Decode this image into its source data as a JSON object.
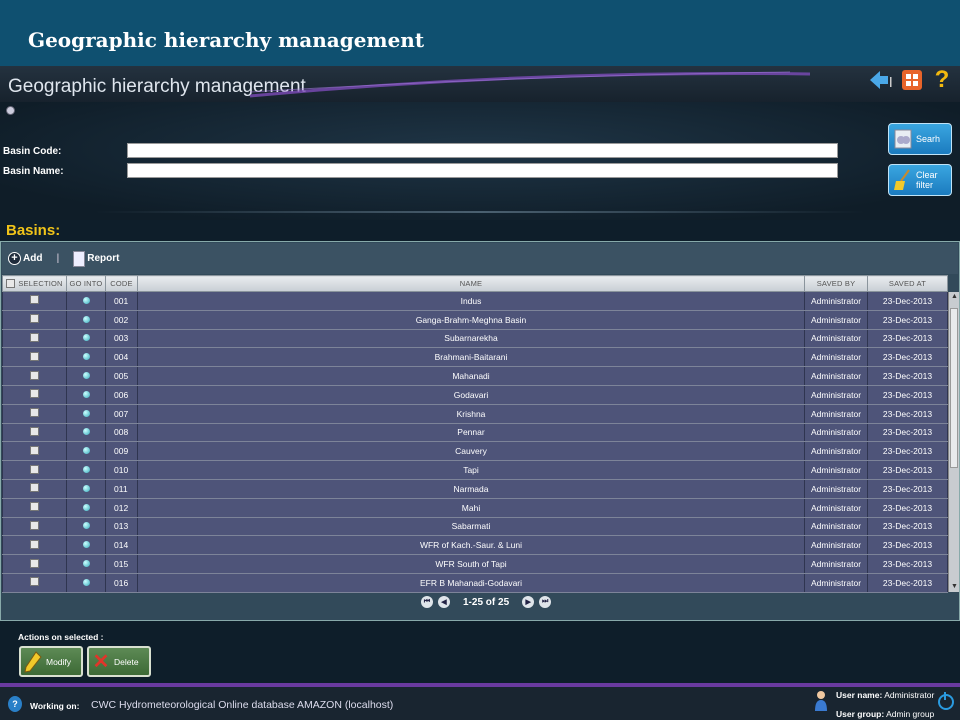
{
  "slide": {
    "title": "Geographic hierarchy management"
  },
  "app": {
    "title": "Geographic hierarchy management",
    "icons": [
      "back-arrow-icon",
      "grid-icon",
      "help-icon"
    ]
  },
  "filters": {
    "basin_code_label": "Basin Code:",
    "basin_code_value": "",
    "basin_name_label": "Basin Name:",
    "basin_name_value": "",
    "search_label": "Searh",
    "clear_label": "Clear filter"
  },
  "section": {
    "title": "Basins:"
  },
  "toolbar": {
    "add_label": "Add",
    "separator": "|",
    "report_label": "Report"
  },
  "grid": {
    "columns": [
      "SELECTION",
      "GO INTO",
      "CODE",
      "NAME",
      "SAVED BY",
      "SAVED AT"
    ],
    "rows": [
      {
        "code": "001",
        "name": "Indus",
        "saved_by": "Administrator",
        "saved_at": "23-Dec-2013"
      },
      {
        "code": "002",
        "name": "Ganga-Brahm-Meghna Basin",
        "saved_by": "Administrator",
        "saved_at": "23-Dec-2013"
      },
      {
        "code": "003",
        "name": "Subarnarekha",
        "saved_by": "Administrator",
        "saved_at": "23-Dec-2013"
      },
      {
        "code": "004",
        "name": "Brahmani-Baitarani",
        "saved_by": "Administrator",
        "saved_at": "23-Dec-2013"
      },
      {
        "code": "005",
        "name": "Mahanadi",
        "saved_by": "Administrator",
        "saved_at": "23-Dec-2013"
      },
      {
        "code": "006",
        "name": "Godavari",
        "saved_by": "Administrator",
        "saved_at": "23-Dec-2013"
      },
      {
        "code": "007",
        "name": "Krishna",
        "saved_by": "Administrator",
        "saved_at": "23-Dec-2013"
      },
      {
        "code": "008",
        "name": "Pennar",
        "saved_by": "Administrator",
        "saved_at": "23-Dec-2013"
      },
      {
        "code": "009",
        "name": "Cauvery",
        "saved_by": "Administrator",
        "saved_at": "23-Dec-2013"
      },
      {
        "code": "010",
        "name": "Tapi",
        "saved_by": "Administrator",
        "saved_at": "23-Dec-2013"
      },
      {
        "code": "011",
        "name": "Narmada",
        "saved_by": "Administrator",
        "saved_at": "23-Dec-2013"
      },
      {
        "code": "012",
        "name": "Mahi",
        "saved_by": "Administrator",
        "saved_at": "23-Dec-2013"
      },
      {
        "code": "013",
        "name": "Sabarmati",
        "saved_by": "Administrator",
        "saved_at": "23-Dec-2013"
      },
      {
        "code": "014",
        "name": "WFR of Kach.-Saur. & Luni",
        "saved_by": "Administrator",
        "saved_at": "23-Dec-2013"
      },
      {
        "code": "015",
        "name": "WFR South of Tapi",
        "saved_by": "Administrator",
        "saved_at": "23-Dec-2013"
      },
      {
        "code": "016",
        "name": "EFR B Mahanadi-Godavari",
        "saved_by": "Administrator",
        "saved_at": "23-Dec-2013"
      }
    ]
  },
  "pager": {
    "text": "1-25 of 25"
  },
  "actions": {
    "label": "Actions on selected :",
    "modify_label": "Modify",
    "delete_label": "Delete"
  },
  "footer": {
    "working_on_label": "Working on:",
    "working_on_value": "CWC Hydrometeorological Online database AMAZON (localhost)",
    "user_name_label": "User name:",
    "user_name_value": "Administrator",
    "user_group_label": "User group:",
    "user_group_value": "Admin group"
  },
  "colors": {
    "slide_header": "#0f5070",
    "accent_yellow": "#f0c419",
    "button_blue": "#1b7bbf",
    "action_green": "#4a7a42",
    "row_bg": "#4e5479",
    "footer_accent": "#6a3aa0"
  }
}
